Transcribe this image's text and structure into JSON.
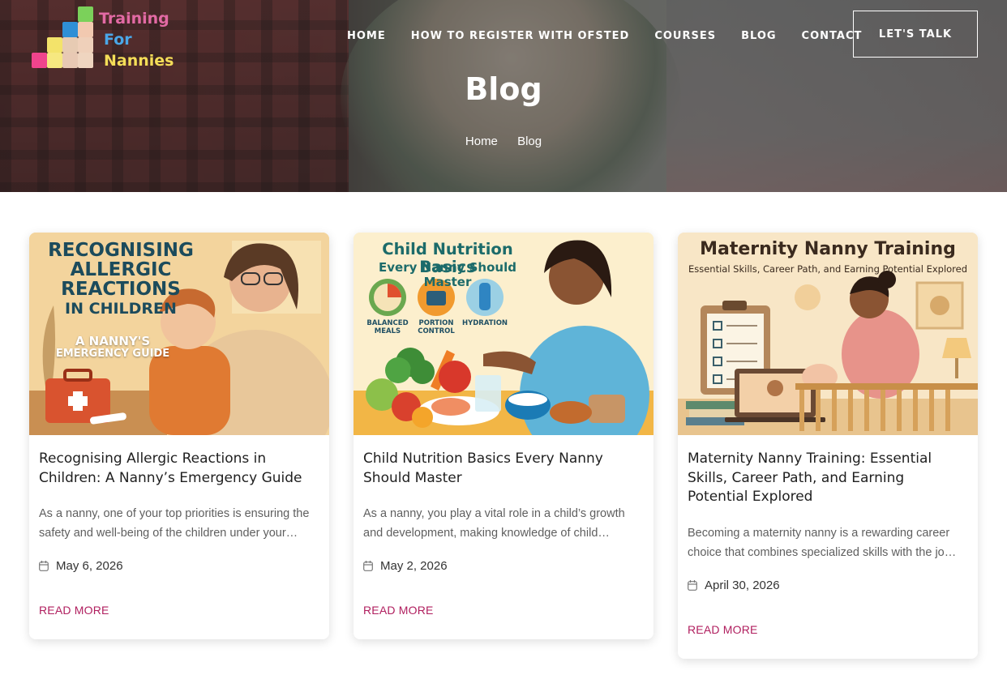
{
  "brand": {
    "line1": "Training",
    "line2": "For",
    "line3": "Nannies"
  },
  "nav": {
    "items": [
      "HOME",
      "HOW TO REGISTER WITH OFSTED",
      "COURSES",
      "BLOG",
      "CONTACT"
    ],
    "cta": "LET'S TALK"
  },
  "hero": {
    "title": "Blog",
    "breadcrumb": [
      "Home",
      "Blog"
    ]
  },
  "posts": [
    {
      "title": "Recognising Allergic Reactions in Children: A Nanny’s Emergency Guide",
      "excerpt": "As a nanny, one of your top priorities is ensuring the safety and well-being of the children under your…",
      "date": "May 6, 2026",
      "read_more": "READ MORE",
      "image": {
        "title_lines": [
          "RECOGNISING",
          "ALLERGIC",
          "REACTIONS",
          "IN CHILDREN"
        ],
        "subtitle_lines": [
          "A NANNY'S",
          "EMERGENCY GUIDE"
        ]
      }
    },
    {
      "title": "Child Nutrition Basics Every Nanny Should Master",
      "excerpt": "As a nanny, you play a vital role in a child’s growth and development, making knowledge of child…",
      "date": "May 2, 2026",
      "read_more": "READ MORE",
      "image": {
        "title": "Child Nutrition Basics",
        "subtitle": "Every Nanny Should Master",
        "icons": [
          "BALANCED\nMEALS",
          "PORTION\nCONTROL",
          "HYDRATION"
        ]
      }
    },
    {
      "title": "Maternity Nanny Training: Essential Skills, Career Path, and Earning Potential Explored",
      "excerpt": "Becoming a maternity nanny is a rewarding career choice that combines specialized skills with the jo…",
      "date": "April 30, 2026",
      "read_more": "READ MORE",
      "image": {
        "title": "Maternity Nanny Training",
        "subtitle": "Essential Skills, Career Path, and Earning Potential Explored"
      }
    }
  ]
}
